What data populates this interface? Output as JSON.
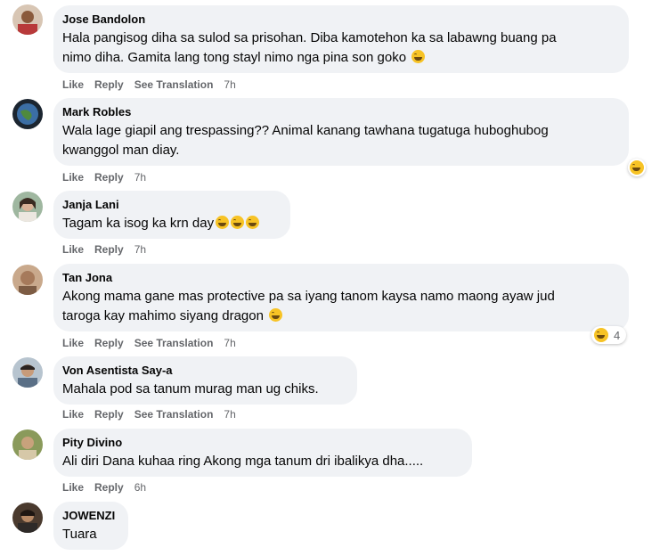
{
  "actions": {
    "like": "Like",
    "reply": "Reply",
    "see_translation": "See Translation"
  },
  "colors": {
    "bubble": "#f0f2f5",
    "meta_text": "#65676b",
    "emoji": "#f7c325"
  },
  "comments": [
    {
      "author": "Jose Bandolon",
      "line1": "Hala pangisog diha sa sulod sa prisohan. Diba kamotehon ka sa labawng buang pa",
      "line2": "nimo diha. Gamita lang tong stayl nimo nga pina son goko",
      "time": "7h",
      "emoji": "laughing-emoji"
    },
    {
      "author": "Mark Robles",
      "line1": "Wala lage giapil ang trespassing?? Animal kanang tawhana tugatuga huboghubog",
      "line2": "kwanggol man diay.",
      "time": "7h",
      "reaction": "haha-reaction"
    },
    {
      "author": "Janja Lani",
      "line1": "Tagam ka isog ka krn day",
      "time": "7h",
      "emoji": "rolling-laughing-emoji"
    },
    {
      "author": "Tan Jona",
      "line1": "Akong mama gane mas protective pa sa iyang tanom kaysa namo maong ayaw jud",
      "line2": "taroga kay mahimo siyang dragon",
      "time": "7h",
      "reaction_count": "4"
    },
    {
      "author": "Von Asentista Say-a",
      "line1": "Mahala pod sa tanum murag man ug chiks.",
      "time": "7h"
    },
    {
      "author": "Pity Divino",
      "line1": "Ali diri Dana kuhaa ring Akong mga tanum dri ibalikya dha.....",
      "time": "6h"
    },
    {
      "author": "JOWENZI",
      "line1": "Tuara"
    }
  ]
}
